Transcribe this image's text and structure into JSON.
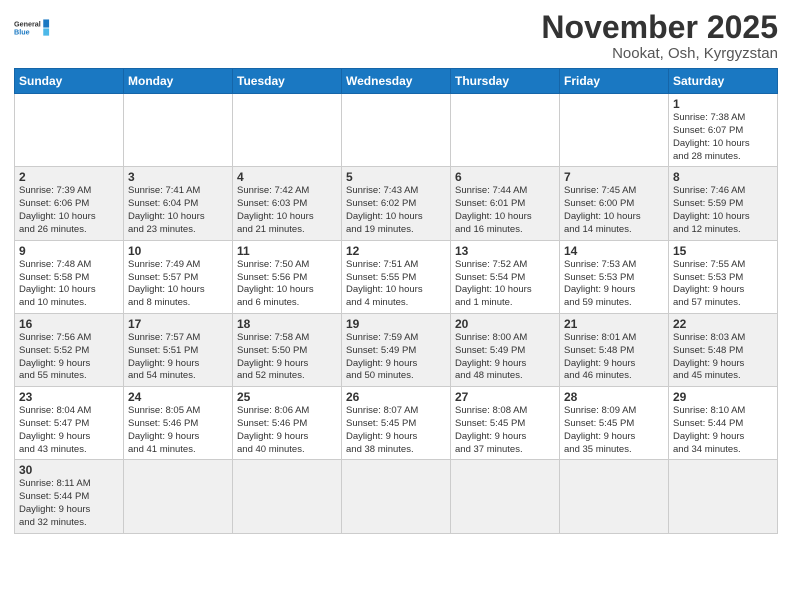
{
  "logo": {
    "text_general": "General",
    "text_blue": "Blue"
  },
  "header": {
    "month_title": "November 2025",
    "location": "Nookat, Osh, Kyrgyzstan"
  },
  "weekdays": [
    "Sunday",
    "Monday",
    "Tuesday",
    "Wednesday",
    "Thursday",
    "Friday",
    "Saturday"
  ],
  "weeks": [
    [
      {
        "day": "",
        "info": ""
      },
      {
        "day": "",
        "info": ""
      },
      {
        "day": "",
        "info": ""
      },
      {
        "day": "",
        "info": ""
      },
      {
        "day": "",
        "info": ""
      },
      {
        "day": "",
        "info": ""
      },
      {
        "day": "1",
        "info": "Sunrise: 7:38 AM\nSunset: 6:07 PM\nDaylight: 10 hours\nand 28 minutes."
      }
    ],
    [
      {
        "day": "2",
        "info": "Sunrise: 7:39 AM\nSunset: 6:06 PM\nDaylight: 10 hours\nand 26 minutes."
      },
      {
        "day": "3",
        "info": "Sunrise: 7:41 AM\nSunset: 6:04 PM\nDaylight: 10 hours\nand 23 minutes."
      },
      {
        "day": "4",
        "info": "Sunrise: 7:42 AM\nSunset: 6:03 PM\nDaylight: 10 hours\nand 21 minutes."
      },
      {
        "day": "5",
        "info": "Sunrise: 7:43 AM\nSunset: 6:02 PM\nDaylight: 10 hours\nand 19 minutes."
      },
      {
        "day": "6",
        "info": "Sunrise: 7:44 AM\nSunset: 6:01 PM\nDaylight: 10 hours\nand 16 minutes."
      },
      {
        "day": "7",
        "info": "Sunrise: 7:45 AM\nSunset: 6:00 PM\nDaylight: 10 hours\nand 14 minutes."
      },
      {
        "day": "8",
        "info": "Sunrise: 7:46 AM\nSunset: 5:59 PM\nDaylight: 10 hours\nand 12 minutes."
      }
    ],
    [
      {
        "day": "9",
        "info": "Sunrise: 7:48 AM\nSunset: 5:58 PM\nDaylight: 10 hours\nand 10 minutes."
      },
      {
        "day": "10",
        "info": "Sunrise: 7:49 AM\nSunset: 5:57 PM\nDaylight: 10 hours\nand 8 minutes."
      },
      {
        "day": "11",
        "info": "Sunrise: 7:50 AM\nSunset: 5:56 PM\nDaylight: 10 hours\nand 6 minutes."
      },
      {
        "day": "12",
        "info": "Sunrise: 7:51 AM\nSunset: 5:55 PM\nDaylight: 10 hours\nand 4 minutes."
      },
      {
        "day": "13",
        "info": "Sunrise: 7:52 AM\nSunset: 5:54 PM\nDaylight: 10 hours\nand 1 minute."
      },
      {
        "day": "14",
        "info": "Sunrise: 7:53 AM\nSunset: 5:53 PM\nDaylight: 9 hours\nand 59 minutes."
      },
      {
        "day": "15",
        "info": "Sunrise: 7:55 AM\nSunset: 5:53 PM\nDaylight: 9 hours\nand 57 minutes."
      }
    ],
    [
      {
        "day": "16",
        "info": "Sunrise: 7:56 AM\nSunset: 5:52 PM\nDaylight: 9 hours\nand 55 minutes."
      },
      {
        "day": "17",
        "info": "Sunrise: 7:57 AM\nSunset: 5:51 PM\nDaylight: 9 hours\nand 54 minutes."
      },
      {
        "day": "18",
        "info": "Sunrise: 7:58 AM\nSunset: 5:50 PM\nDaylight: 9 hours\nand 52 minutes."
      },
      {
        "day": "19",
        "info": "Sunrise: 7:59 AM\nSunset: 5:49 PM\nDaylight: 9 hours\nand 50 minutes."
      },
      {
        "day": "20",
        "info": "Sunrise: 8:00 AM\nSunset: 5:49 PM\nDaylight: 9 hours\nand 48 minutes."
      },
      {
        "day": "21",
        "info": "Sunrise: 8:01 AM\nSunset: 5:48 PM\nDaylight: 9 hours\nand 46 minutes."
      },
      {
        "day": "22",
        "info": "Sunrise: 8:03 AM\nSunset: 5:48 PM\nDaylight: 9 hours\nand 45 minutes."
      }
    ],
    [
      {
        "day": "23",
        "info": "Sunrise: 8:04 AM\nSunset: 5:47 PM\nDaylight: 9 hours\nand 43 minutes."
      },
      {
        "day": "24",
        "info": "Sunrise: 8:05 AM\nSunset: 5:46 PM\nDaylight: 9 hours\nand 41 minutes."
      },
      {
        "day": "25",
        "info": "Sunrise: 8:06 AM\nSunset: 5:46 PM\nDaylight: 9 hours\nand 40 minutes."
      },
      {
        "day": "26",
        "info": "Sunrise: 8:07 AM\nSunset: 5:45 PM\nDaylight: 9 hours\nand 38 minutes."
      },
      {
        "day": "27",
        "info": "Sunrise: 8:08 AM\nSunset: 5:45 PM\nDaylight: 9 hours\nand 37 minutes."
      },
      {
        "day": "28",
        "info": "Sunrise: 8:09 AM\nSunset: 5:45 PM\nDaylight: 9 hours\nand 35 minutes."
      },
      {
        "day": "29",
        "info": "Sunrise: 8:10 AM\nSunset: 5:44 PM\nDaylight: 9 hours\nand 34 minutes."
      }
    ],
    [
      {
        "day": "30",
        "info": "Sunrise: 8:11 AM\nSunset: 5:44 PM\nDaylight: 9 hours\nand 32 minutes."
      },
      {
        "day": "",
        "info": ""
      },
      {
        "day": "",
        "info": ""
      },
      {
        "day": "",
        "info": ""
      },
      {
        "day": "",
        "info": ""
      },
      {
        "day": "",
        "info": ""
      },
      {
        "day": "",
        "info": ""
      }
    ]
  ]
}
